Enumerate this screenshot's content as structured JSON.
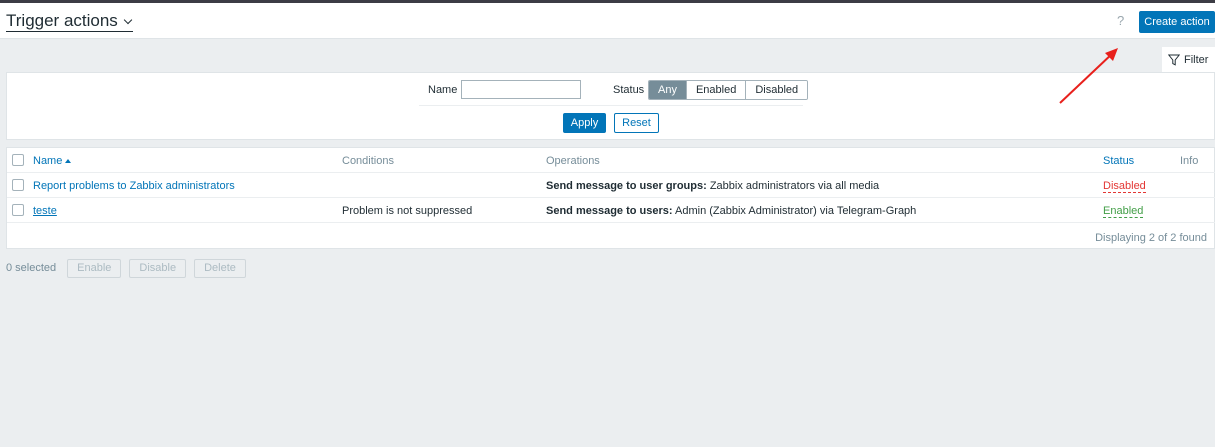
{
  "header": {
    "title": "Trigger actions",
    "help": "?",
    "create_button": "Create action"
  },
  "filter": {
    "tab_label": "Filter",
    "name_label": "Name",
    "name_value": "",
    "status_label": "Status",
    "status_options": [
      "Any",
      "Enabled",
      "Disabled"
    ],
    "status_selected": "Any",
    "apply": "Apply",
    "reset": "Reset"
  },
  "table": {
    "columns": {
      "name": "Name",
      "conditions": "Conditions",
      "operations": "Operations",
      "status": "Status",
      "info": "Info"
    },
    "rows": [
      {
        "name": "Report problems to Zabbix administrators",
        "conditions": "",
        "op_label": "Send message to user groups:",
        "op_value": "Zabbix administrators via all media",
        "status": "Disabled"
      },
      {
        "name": "teste",
        "conditions": "Problem is not suppressed",
        "op_label": "Send message to users:",
        "op_value": "Admin (Zabbix Administrator) via Telegram-Graph",
        "status": "Enabled"
      }
    ],
    "footer": "Displaying 2 of 2 found"
  },
  "bulk": {
    "selected": "0 selected",
    "enable": "Enable",
    "disable": "Disable",
    "delete": "Delete"
  },
  "colors": {
    "primary": "#0275b8",
    "disabled_status": "#e33734",
    "enabled_status": "#429e47",
    "annotation_arrow": "#e8201c"
  }
}
